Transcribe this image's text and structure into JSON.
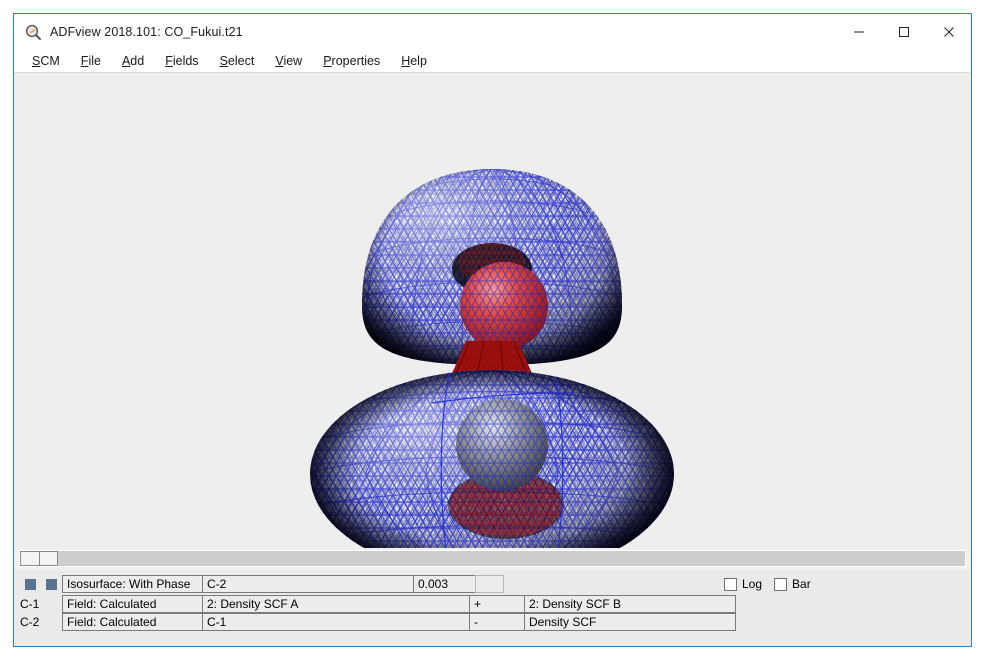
{
  "window": {
    "title": "ADFview 2018.101: CO_Fukui.t21",
    "icon": "magnifier-icon",
    "border_color": "#2a7fd4",
    "controls": [
      {
        "name": "minimize",
        "glyph": "minimize-icon"
      },
      {
        "name": "maximize",
        "glyph": "maximize-icon"
      },
      {
        "name": "close",
        "glyph": "close-icon"
      }
    ]
  },
  "menubar": {
    "items": [
      {
        "mnemonic": "S",
        "rest": "CM"
      },
      {
        "mnemonic": "F",
        "rest": "ile"
      },
      {
        "mnemonic": "A",
        "rest": "dd"
      },
      {
        "mnemonic": "F",
        "rest": "ields"
      },
      {
        "mnemonic": "S",
        "rest": "elect"
      },
      {
        "mnemonic": "V",
        "rest": "iew"
      },
      {
        "mnemonic": "P",
        "rest": "roperties"
      },
      {
        "mnemonic": "H",
        "rest": "elp"
      }
    ]
  },
  "viewport": {
    "background": "#eeeeee",
    "scene_description": "CO molecule Fukui function isosurface",
    "atoms": [
      {
        "label": "O",
        "color": "#cc2222",
        "position": "upper"
      },
      {
        "label": "C",
        "color": "#8a8a8a",
        "position": "lower"
      }
    ],
    "isosurface_colors": {
      "positive": "#1414c8",
      "negative": "#c81414"
    }
  },
  "scrollbar": {
    "name": "horizontal-scrollbar",
    "thumb_position": "left"
  },
  "fields_panel": {
    "row1": {
      "swatches": [
        "#5b7291",
        "#5b7291"
      ],
      "type": "Isosurface: With Phase",
      "source": "C-2",
      "value": "0.003"
    },
    "row2": {
      "label": "C-1",
      "type": "Field: Calculated",
      "operand_a": "2: Density SCF A",
      "operator": "+",
      "operand_b": "2: Density SCF B"
    },
    "row3": {
      "label": "C-2",
      "type": "Field: Calculated",
      "operand_a": "C-1",
      "operator": "-",
      "operand_b": "Density SCF"
    },
    "options": [
      {
        "name": "log",
        "label": "Log",
        "checked": false
      },
      {
        "name": "bar",
        "label": "Bar",
        "checked": false
      }
    ]
  }
}
